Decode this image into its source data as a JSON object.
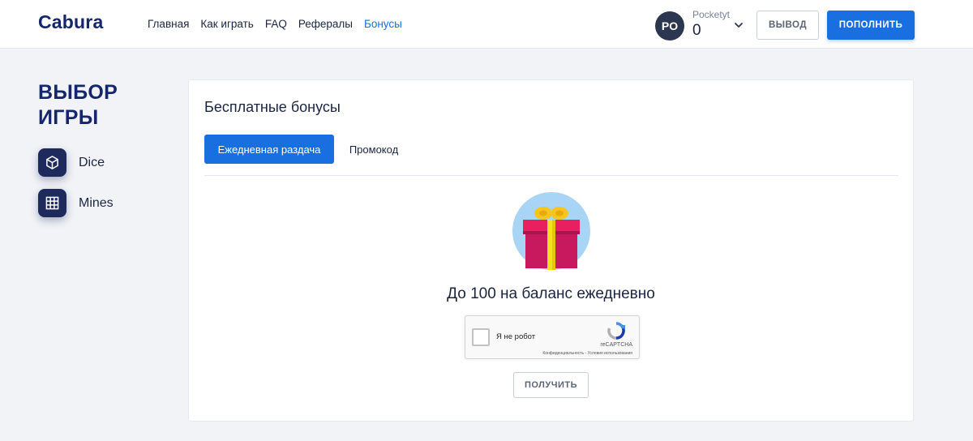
{
  "header": {
    "logo": "Cabura",
    "nav": [
      "Главная",
      "Как играть",
      "FAQ",
      "Рефералы",
      "Бонусы"
    ],
    "active_nav": "Бонусы",
    "user": {
      "initials": "PO",
      "name": "Pocketyt",
      "balance": "0"
    },
    "withdraw_label": "ВЫВОД",
    "deposit_label": "ПОПОЛНИТЬ"
  },
  "sidebar": {
    "title": "ВЫБОР ИГРЫ",
    "games": [
      {
        "label": "Dice",
        "icon": "cube-icon"
      },
      {
        "label": "Mines",
        "icon": "grid-icon"
      }
    ]
  },
  "bonus_card": {
    "title": "Бесплатные бонусы",
    "tabs": [
      "Ежедневная раздача",
      "Промокод"
    ],
    "active_tab": "Ежедневная раздача",
    "gift_icon": "gift-icon",
    "bonus_text": "До 100 на баланс ежедневно",
    "captcha": {
      "label": "Я не робот",
      "brand": "reCAPTCHA",
      "links": "Конфиденциальность - Условия использования"
    },
    "get_label": "ПОЛУЧИТЬ"
  },
  "colors": {
    "accent": "#1a6fe0",
    "brand": "#15276a",
    "background": "#f1f3f7"
  }
}
